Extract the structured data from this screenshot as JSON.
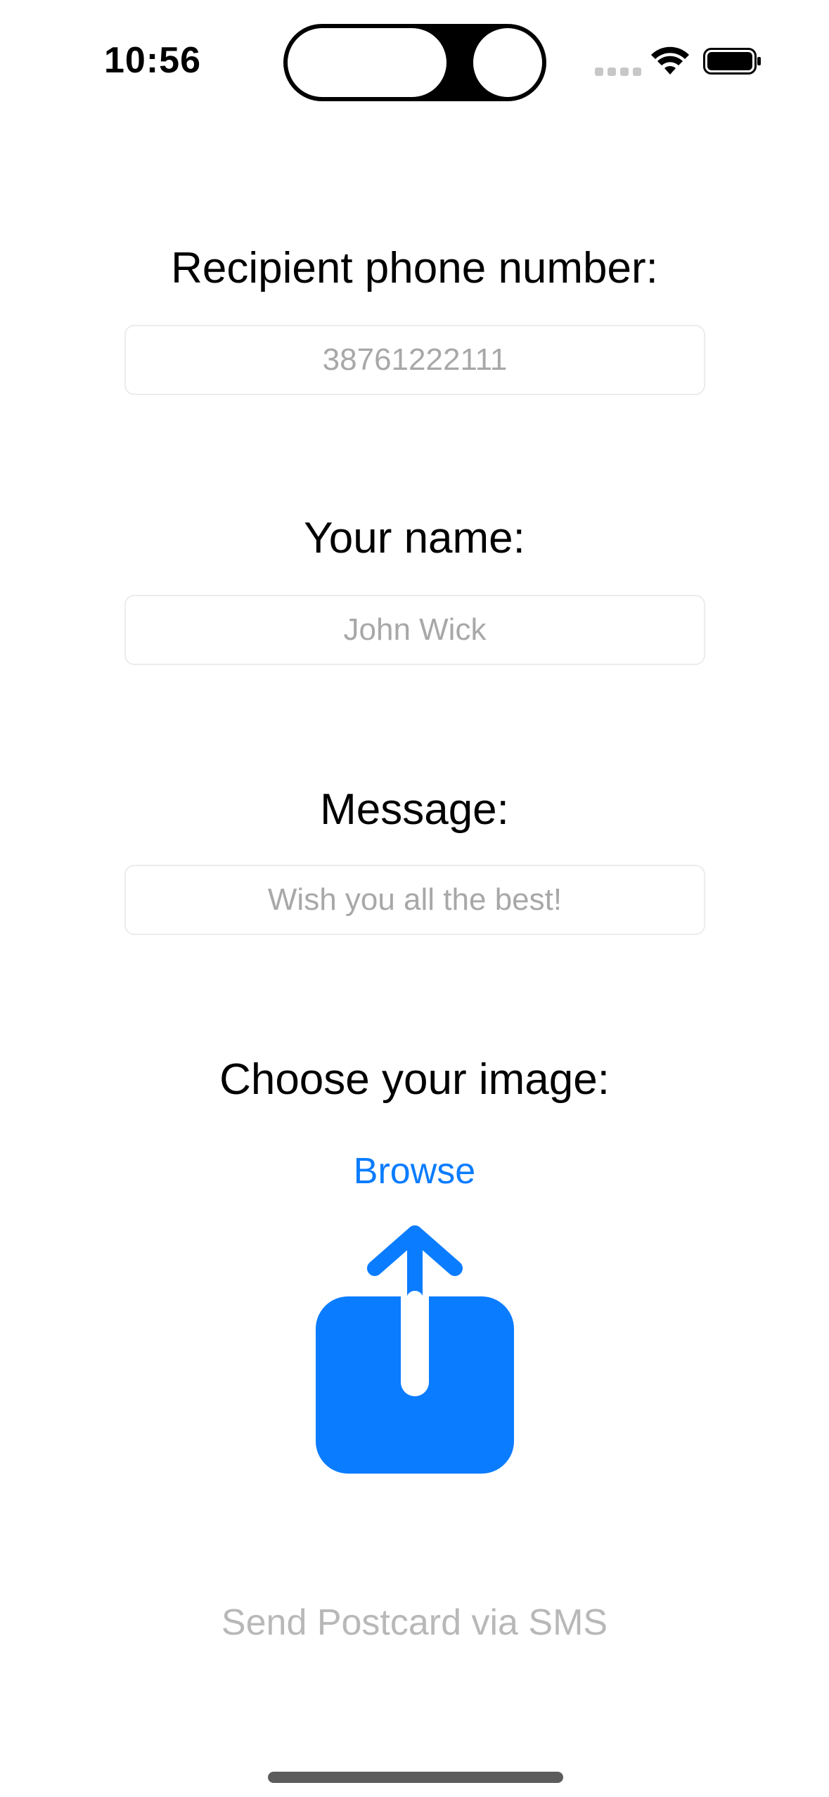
{
  "status_bar": {
    "time": "10:56",
    "icons": [
      "cellular-signal-icon",
      "wifi-icon",
      "battery-icon"
    ]
  },
  "form": {
    "phone": {
      "label": "Recipient phone number:",
      "placeholder": "38761222111"
    },
    "name": {
      "label": "Your name:",
      "placeholder": "John Wick"
    },
    "message": {
      "label": "Message:",
      "placeholder": "Wish you all the best!"
    },
    "image": {
      "label": "Choose your image:",
      "browse_label": "Browse",
      "icon": "share-upload-icon"
    }
  },
  "send_button": {
    "label": "Send Postcard via SMS"
  },
  "colors": {
    "accent": "#0a7cff",
    "placeholder": "#a8a8a8",
    "disabled": "#b8b8b8"
  }
}
